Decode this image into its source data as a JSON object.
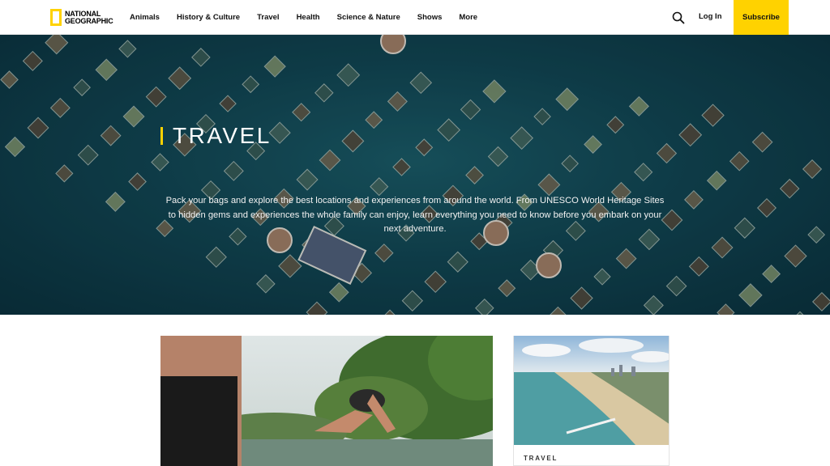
{
  "header": {
    "logo": {
      "line1": "NATIONAL",
      "line2": "GEOGRAPHIC"
    },
    "nav": [
      "Animals",
      "History & Culture",
      "Travel",
      "Health",
      "Science & Nature",
      "Shows",
      "More"
    ],
    "search_icon": "search-icon",
    "login_label": "Log In",
    "subscribe_label": "Subscribe",
    "accent_color": "#ffd200"
  },
  "hero": {
    "title": "TRAVEL",
    "description": "Pack your bags and explore the best locations and experiences from around the world. From UNESCO World Heritage Sites to hidden gems and experiences the whole family can enjoy, learn everything you need to know before you embark on your next adventure."
  },
  "cards": {
    "side": {
      "tag": "TRAVEL"
    }
  }
}
